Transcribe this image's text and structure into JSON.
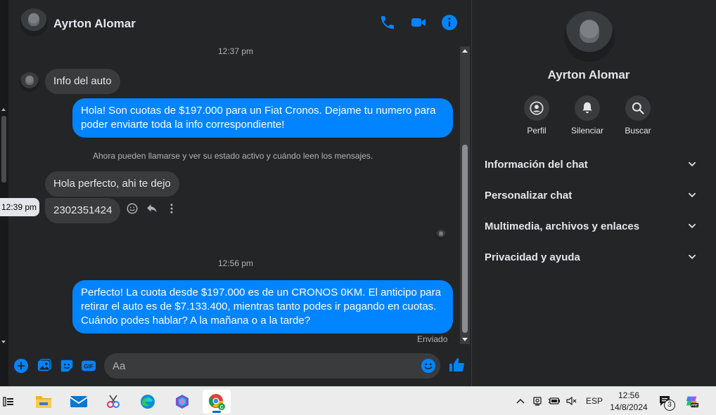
{
  "header": {
    "contact_name": "Ayrton Alomar"
  },
  "messages": {
    "ts1": "12:37 pm",
    "info_auto": "Info del auto",
    "reply1": "Hola! Son cuotas de $197.000 para un Fiat Cronos. Dejame tu numero para poder enviarte toda la info correspondiente!",
    "system_note": "Ahora pueden llamarse y ver su estado activo y cuándo leen los mensajes.",
    "hola_perfecto": "Hola perfecto, ahi te dejo",
    "phone": "2302351424",
    "hover_time": "12:39 pm",
    "ts2": "12:56 pm",
    "reply2": "Perfecto! La cuota desde $197.000 es de un CRONOS 0KM. El anticipo para retirar el auto es de $7.133.400, mientras tanto podes ir pagando en cuotas. Cuándo podes hablar? A la mañana o a la tarde?",
    "status": "Enviado"
  },
  "composer": {
    "placeholder": "Aa"
  },
  "panel": {
    "name": "Ayrton Alomar",
    "actions": [
      {
        "label": "Perfil",
        "icon": "profile-icon"
      },
      {
        "label": "Silenciar",
        "icon": "bell-icon"
      },
      {
        "label": "Buscar",
        "icon": "search-icon"
      }
    ],
    "sections": [
      "Información del chat",
      "Personalizar chat",
      "Multimedia, archivos y enlaces",
      "Privacidad y ayuda"
    ]
  },
  "taskbar": {
    "language": "ESP",
    "time": "12:56",
    "date": "14/8/2024",
    "notifications": "3"
  },
  "colors": {
    "accent": "#0084ff",
    "background": "#242526",
    "incoming_bubble": "#3a3b3c"
  }
}
